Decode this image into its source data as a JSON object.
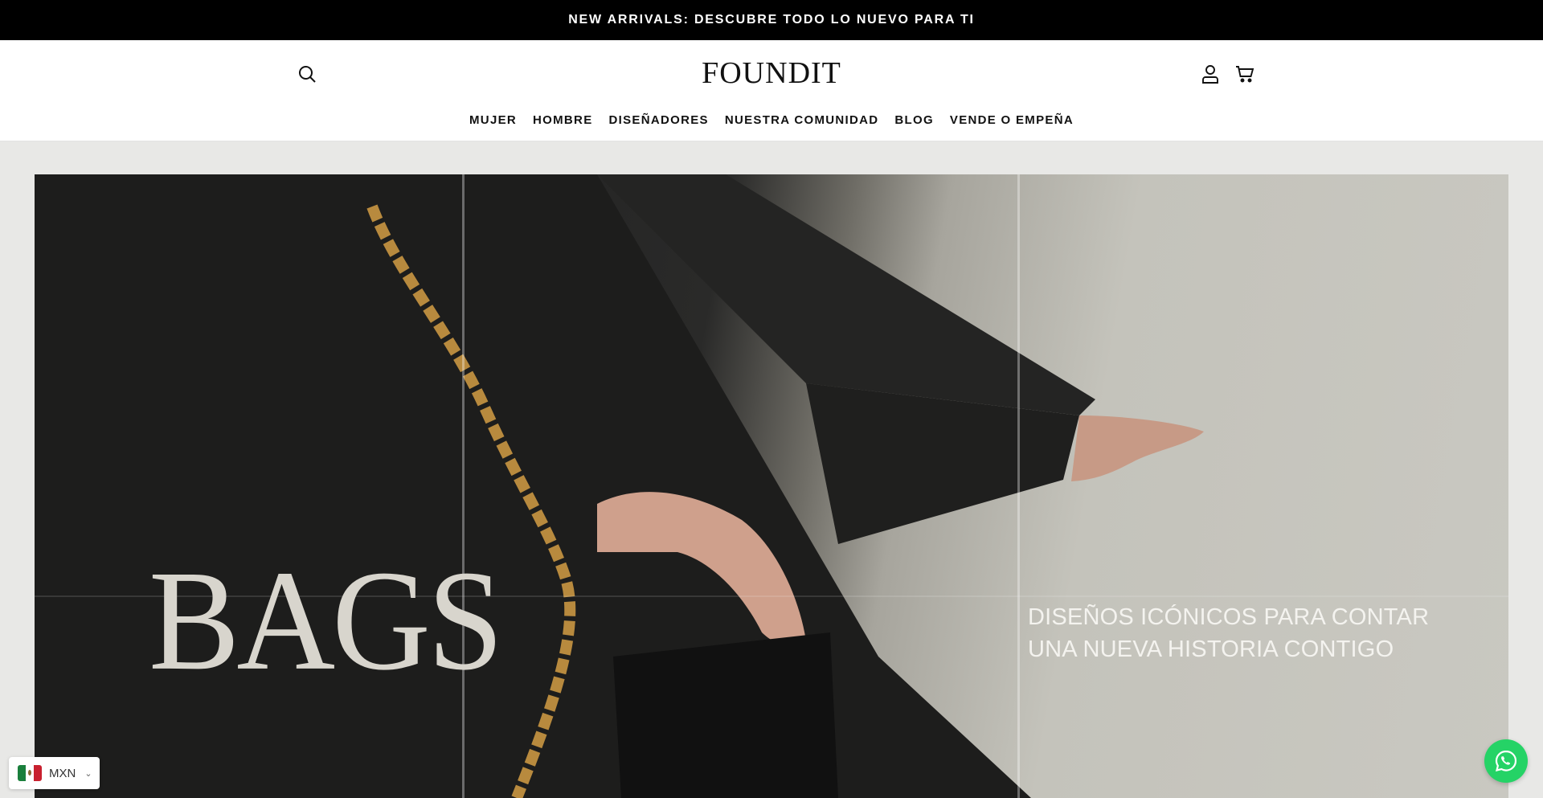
{
  "announcement": {
    "text": "NEW ARRIVALS: DESCUBRE TODO LO NUEVO PARA TI"
  },
  "header": {
    "logo": "FOUNDIT",
    "icons": {
      "search": "search-icon",
      "account": "user-icon",
      "cart": "cart-icon"
    }
  },
  "nav": {
    "items": [
      {
        "label": "MUJER"
      },
      {
        "label": "HOMBRE"
      },
      {
        "label": "DISEÑADORES"
      },
      {
        "label": "NUESTRA COMUNIDAD"
      },
      {
        "label": "BLOG"
      },
      {
        "label": "VENDE O EMPEÑA"
      }
    ]
  },
  "hero": {
    "title": "BAGS",
    "tagline": "DISEÑOS ICÓNICOS PARA CONTAR UNA NUEVA HISTORIA CONTIGO"
  },
  "currency": {
    "code": "MXN",
    "flag_icon": "mexico-flag-icon"
  },
  "whatsapp": {
    "icon": "whatsapp-icon",
    "color": "#25d366"
  },
  "colors": {
    "announcement_bg": "#000000",
    "hero_backdrop": "#e8e8e6",
    "text": "#111111"
  }
}
